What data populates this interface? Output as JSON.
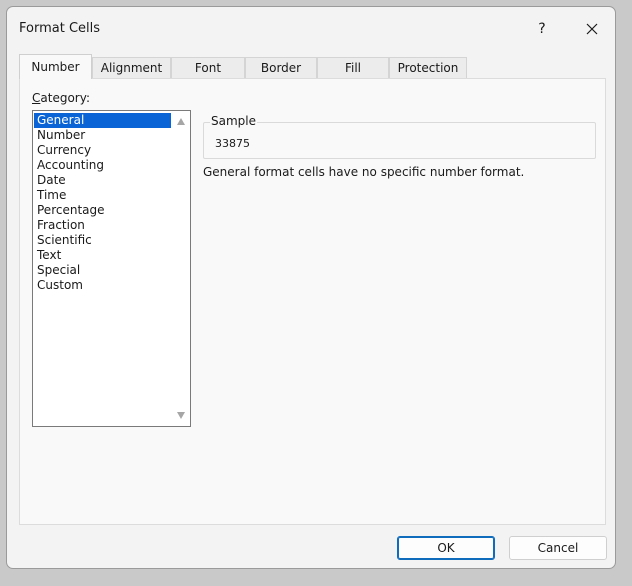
{
  "window": {
    "title": "Format Cells",
    "help_label": "?",
    "close_icon": "close-icon"
  },
  "tabs": [
    {
      "label": "Number",
      "active": true
    },
    {
      "label": "Alignment",
      "active": false
    },
    {
      "label": "Font",
      "active": false
    },
    {
      "label": "Border",
      "active": false
    },
    {
      "label": "Fill",
      "active": false
    },
    {
      "label": "Protection",
      "active": false
    }
  ],
  "category": {
    "label_first": "C",
    "label_rest": "ategory:",
    "items": [
      "General",
      "Number",
      "Currency",
      "Accounting",
      "Date",
      "Time",
      "Percentage",
      "Fraction",
      "Scientific",
      "Text",
      "Special",
      "Custom"
    ],
    "selected": "General"
  },
  "sample": {
    "label": "Sample",
    "value": "33875"
  },
  "description": "General format cells have no specific number format.",
  "buttons": {
    "ok": "OK",
    "cancel": "Cancel"
  },
  "colors": {
    "selection": "#0a64d6",
    "accent": "#0f6cbd"
  }
}
